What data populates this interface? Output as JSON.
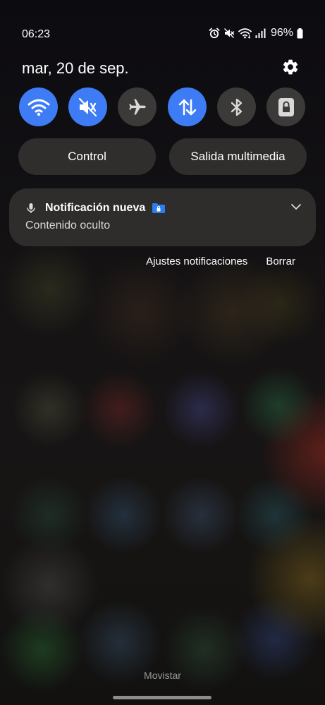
{
  "status_bar": {
    "time": "06:23",
    "battery_percent": "96%",
    "icons": [
      "alarm-icon",
      "mute-icon",
      "wifi-icon",
      "signal-icon",
      "battery-icon"
    ]
  },
  "header": {
    "date": "mar, 20 de sep.",
    "settings_icon": "gear-icon"
  },
  "quick_toggles": [
    {
      "name": "wifi",
      "icon": "wifi-icon",
      "state": "on"
    },
    {
      "name": "mute",
      "icon": "mute-icon",
      "state": "on"
    },
    {
      "name": "airplane-mode",
      "icon": "airplane-icon",
      "state": "off"
    },
    {
      "name": "mobile-data",
      "icon": "data-arrows-icon",
      "state": "on"
    },
    {
      "name": "bluetooth",
      "icon": "bluetooth-icon",
      "state": "off"
    },
    {
      "name": "screen-lock",
      "icon": "lock-icon",
      "state": "off"
    }
  ],
  "media_buttons": {
    "control_label": "Control",
    "media_output_label": "Salida multimedia"
  },
  "notification": {
    "app_icon": "microphone-icon",
    "title": "Notificación nueva",
    "badge_icon": "secure-folder-icon",
    "body": "Contenido oculto",
    "expand_icon": "chevron-down-icon"
  },
  "notification_actions": {
    "settings_label": "Ajustes notificaciones",
    "clear_label": "Borrar"
  },
  "footer": {
    "carrier": "Movistar"
  },
  "colors": {
    "toggle_on": "#3e7cf5",
    "toggle_off": "#3b3a38",
    "card_bg": "#2e2d2c",
    "folder_icon": "#2b7df0"
  }
}
